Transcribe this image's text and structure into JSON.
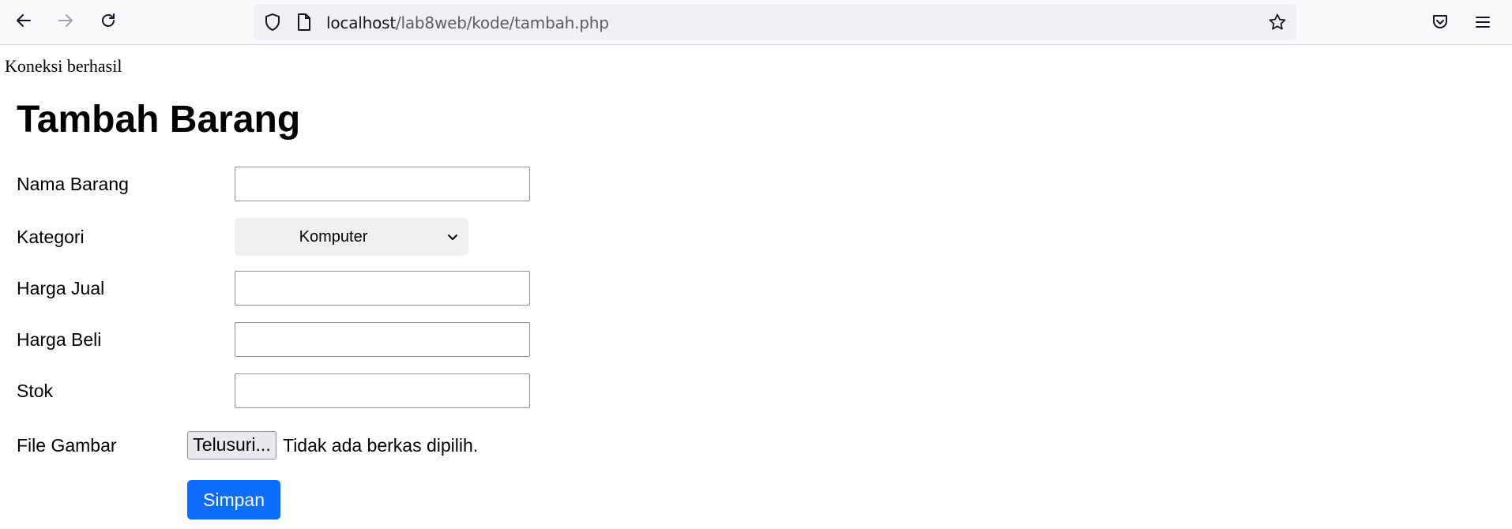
{
  "browser": {
    "url_host": "localhost",
    "url_path": "/lab8web/kode/tambah.php",
    "icons": [
      "back-arrow-icon",
      "forward-arrow-icon",
      "reload-icon",
      "shield-icon",
      "page-icon",
      "bookmark-star-icon",
      "pocket-icon",
      "menu-icon"
    ]
  },
  "page": {
    "status_text": "Koneksi berhasil",
    "title": "Tambah Barang",
    "form": {
      "nama_label": "Nama Barang",
      "nama_value": "",
      "kategori_label": "Kategori",
      "kategori_value": "Komputer",
      "harga_jual_label": "Harga Jual",
      "harga_jual_value": "",
      "harga_beli_label": "Harga Beli",
      "harga_beli_value": "",
      "stok_label": "Stok",
      "stok_value": "",
      "file_label": "File Gambar",
      "file_button": "Telusuri...",
      "file_status": "Tidak ada berkas dipilih.",
      "submit_label": "Simpan"
    }
  },
  "colors": {
    "primary_button": "#0d6efd",
    "toolbar_bg": "#f9f9fb",
    "urlbar_bg": "#f0f0f4"
  }
}
